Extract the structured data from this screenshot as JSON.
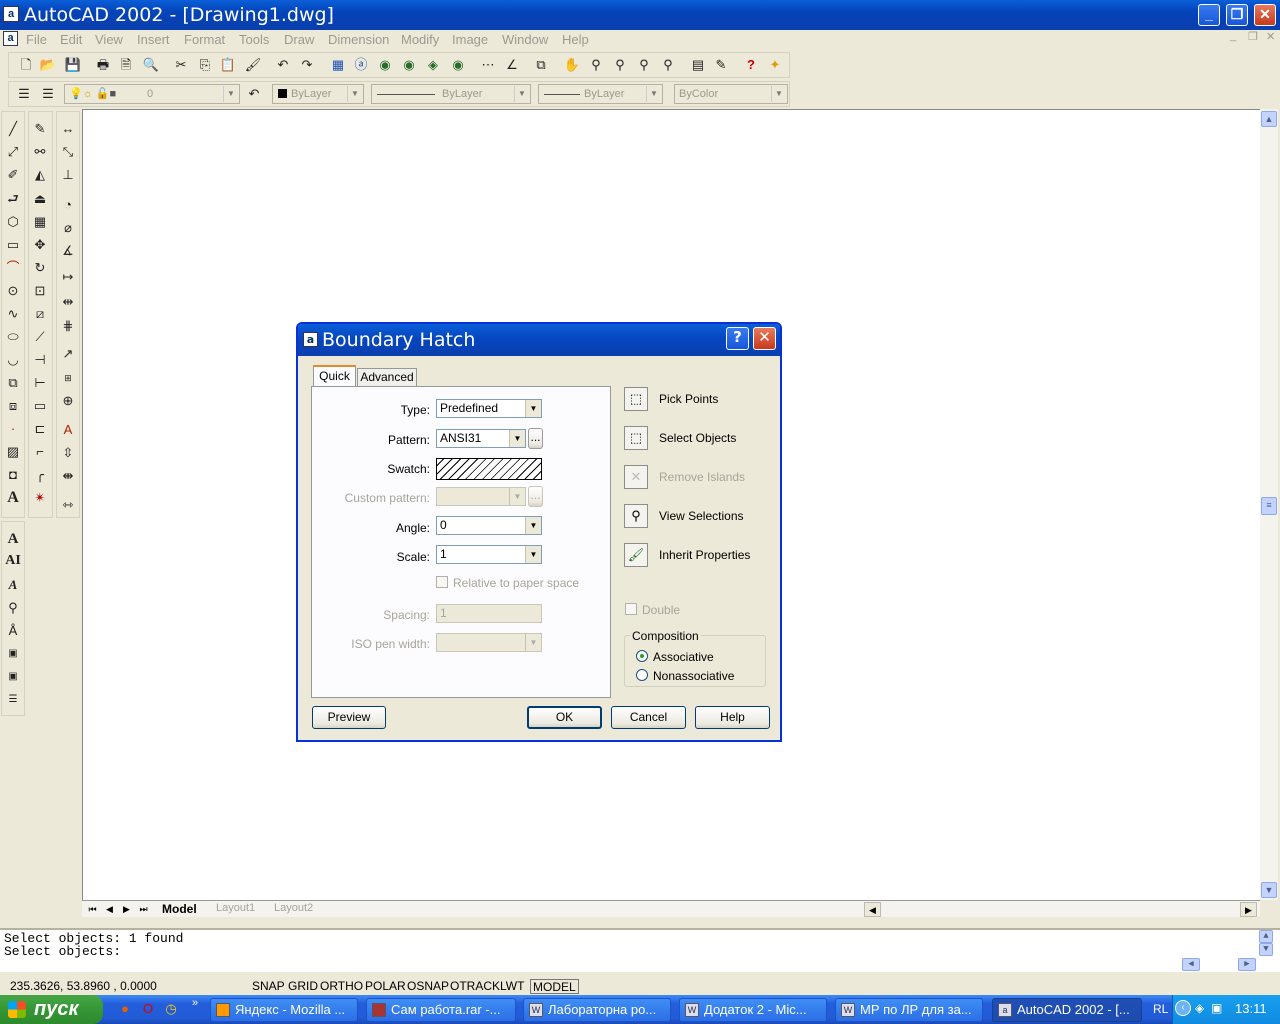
{
  "window": {
    "title": "AutoCAD 2002 - [Drawing1.dwg]",
    "minimize": "_",
    "maximize": "❐",
    "close": "✕"
  },
  "menu": [
    "File",
    "Edit",
    "View",
    "Insert",
    "Format",
    "Tools",
    "Draw",
    "Dimension",
    "Modify",
    "Image",
    "Window",
    "Help"
  ],
  "properties_toolbar": {
    "layer": "0",
    "color": "ByLayer",
    "linetype": "ByLayer",
    "lineweight": "ByLayer",
    "plotstyle": "ByColor"
  },
  "layout_tabs": [
    "Model",
    "Layout1",
    "Layout2"
  ],
  "command_lines": [
    "Select objects: 1 found",
    "Select objects:"
  ],
  "status": {
    "coords": "235.3626, 53.8960 , 0.0000",
    "toggles": [
      "SNAP",
      "GRID",
      "ORTHO",
      "POLAR",
      "OSNAP",
      "OTRACK",
      "LWT",
      "MODEL"
    ]
  },
  "taskbar": {
    "start": "пуск",
    "tasks": [
      "Яндекс - Mozilla ...",
      "Сам работа.rar -...",
      "Лабораторна ро...",
      "Додаток  2 - Mic...",
      "МР по ЛР для за...",
      "AutoCAD 2002 - [..."
    ],
    "lang": "RL",
    "clock": "13:11"
  },
  "dialog": {
    "title": "Boundary Hatch",
    "help": "?",
    "close": "✕",
    "tabs": [
      "Quick",
      "Advanced"
    ],
    "labels": {
      "type": "Type:",
      "pattern": "Pattern:",
      "swatch": "Swatch:",
      "custom": "Custom pattern:",
      "angle": "Angle:",
      "scale": "Scale:",
      "relative": "Relative to paper space",
      "spacing": "Spacing:",
      "iso": "ISO pen width:"
    },
    "values": {
      "type": "Predefined",
      "pattern": "ANSI31",
      "browse": "...",
      "angle": "0",
      "scale": "1",
      "spacing": "1"
    },
    "actions": [
      "Pick Points",
      "Select Objects",
      "Remove Islands",
      "View Selections",
      "Inherit Properties"
    ],
    "double": "Double",
    "composition": {
      "title": "Composition",
      "associative": "Associative",
      "nonassociative": "Nonassociative"
    },
    "buttons": {
      "preview": "Preview",
      "ok": "OK",
      "cancel": "Cancel",
      "help": "Help"
    }
  }
}
